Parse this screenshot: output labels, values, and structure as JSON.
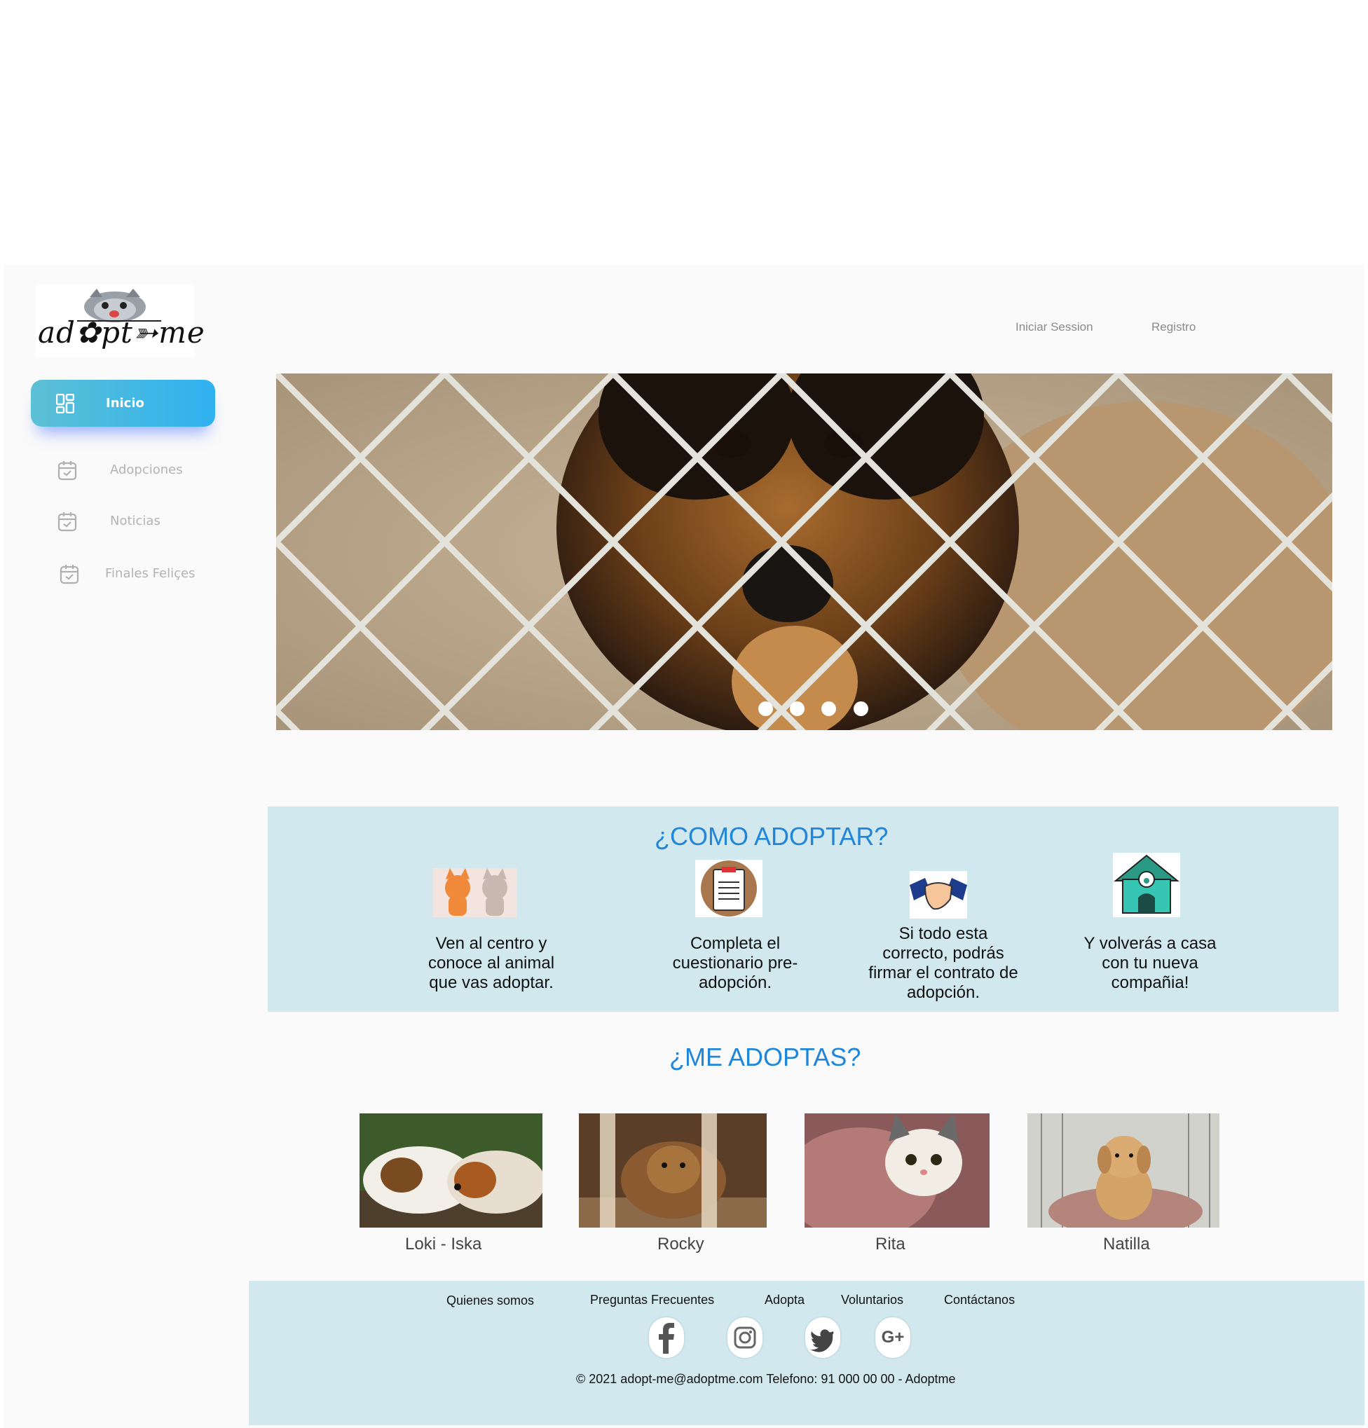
{
  "brand": {
    "logo_text": "ad✿pt➳me"
  },
  "header": {
    "login": "Iniciar Session",
    "register": "Registro"
  },
  "nav": {
    "items": [
      {
        "label": "Inicio",
        "icon": "dashboard-icon"
      },
      {
        "label": "Adopciones",
        "icon": "calendar-icon"
      },
      {
        "label": "Noticias",
        "icon": "calendar-icon"
      },
      {
        "label": "Finales Feliçes",
        "icon": "calendar-icon"
      }
    ]
  },
  "hero": {
    "icon": "dog-behind-fence-image",
    "slides": 4
  },
  "how": {
    "title": "¿COMO ADOPTAR?",
    "steps": [
      {
        "icon": "cat-dog-icon",
        "line1": "Ven al centro y",
        "line2": "conoce al animal",
        "line3": "que vas adoptar.",
        "line4": ""
      },
      {
        "icon": "clipboard-icon",
        "line1": "Completa el",
        "line2": "cuestionario pre-",
        "line3": "adopción.",
        "line4": ""
      },
      {
        "icon": "handshake-icon",
        "line1": "Si todo esta",
        "line2": "correcto, podrás",
        "line3": "firmar el contrato de",
        "line4": "adopción."
      },
      {
        "icon": "doghouse-icon",
        "line1": "Y volverás a casa",
        "line2": "con tu nueva",
        "line3": "compañia!",
        "line4": ""
      }
    ]
  },
  "pets": {
    "title": "¿ME ADOPTAS?",
    "items": [
      {
        "name": "Loki - Iska",
        "icon": "guinea-pigs-photo"
      },
      {
        "name": "Rocky",
        "icon": "dog-photo"
      },
      {
        "name": "Rita",
        "icon": "cat-photo"
      },
      {
        "name": "Natilla",
        "icon": "puppy-photo"
      }
    ]
  },
  "footer": {
    "links": [
      "Quienes somos",
      "Preguntas Frecuentes",
      "Adopta",
      "Voluntarios",
      "Contáctanos"
    ],
    "social": [
      "facebook-icon",
      "instagram-icon",
      "twitter-icon",
      "google-plus-icon"
    ],
    "social_gplus_text": "G+",
    "copyright": "© 2021 adopt-me@adoptme.com  Telefono:  91 000 00 00 - Adoptme"
  }
}
